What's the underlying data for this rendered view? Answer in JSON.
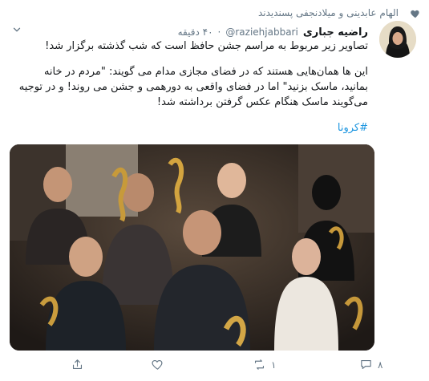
{
  "social_context": "الهام عابدینی و میلادنجفی پسندیدند",
  "author": {
    "display_name": "راضیه جباری",
    "handle": "@raziehjabbari",
    "timestamp": "۴۰ دقیقه"
  },
  "tweet": {
    "line1": "تصاویر زیر مربوط به مراسم جشن حافظ است که شب گذشته برگزار شد!",
    "line2": "این ها همان‌هایی هستند که در فضای مجازی مدام می گویند: \"مردم در خانه بمانید، ماسک بزنید\" اما در فضای واقعی به دورهمی و جشن می روند! و در توجیه می‌گویند ماسک هنگام عکس گرفتن برداشته شد!",
    "hashtag": "#کرونا"
  },
  "actions": {
    "reply_count": "۸",
    "retweet_count": "۱",
    "like_count": ""
  },
  "icons": [
    "heart-icon",
    "caret-down-icon",
    "reply-icon",
    "retweet-icon",
    "like-icon",
    "share-icon"
  ],
  "colors": {
    "link": "#1b95e0",
    "muted": "#657786",
    "text": "#14171a"
  }
}
